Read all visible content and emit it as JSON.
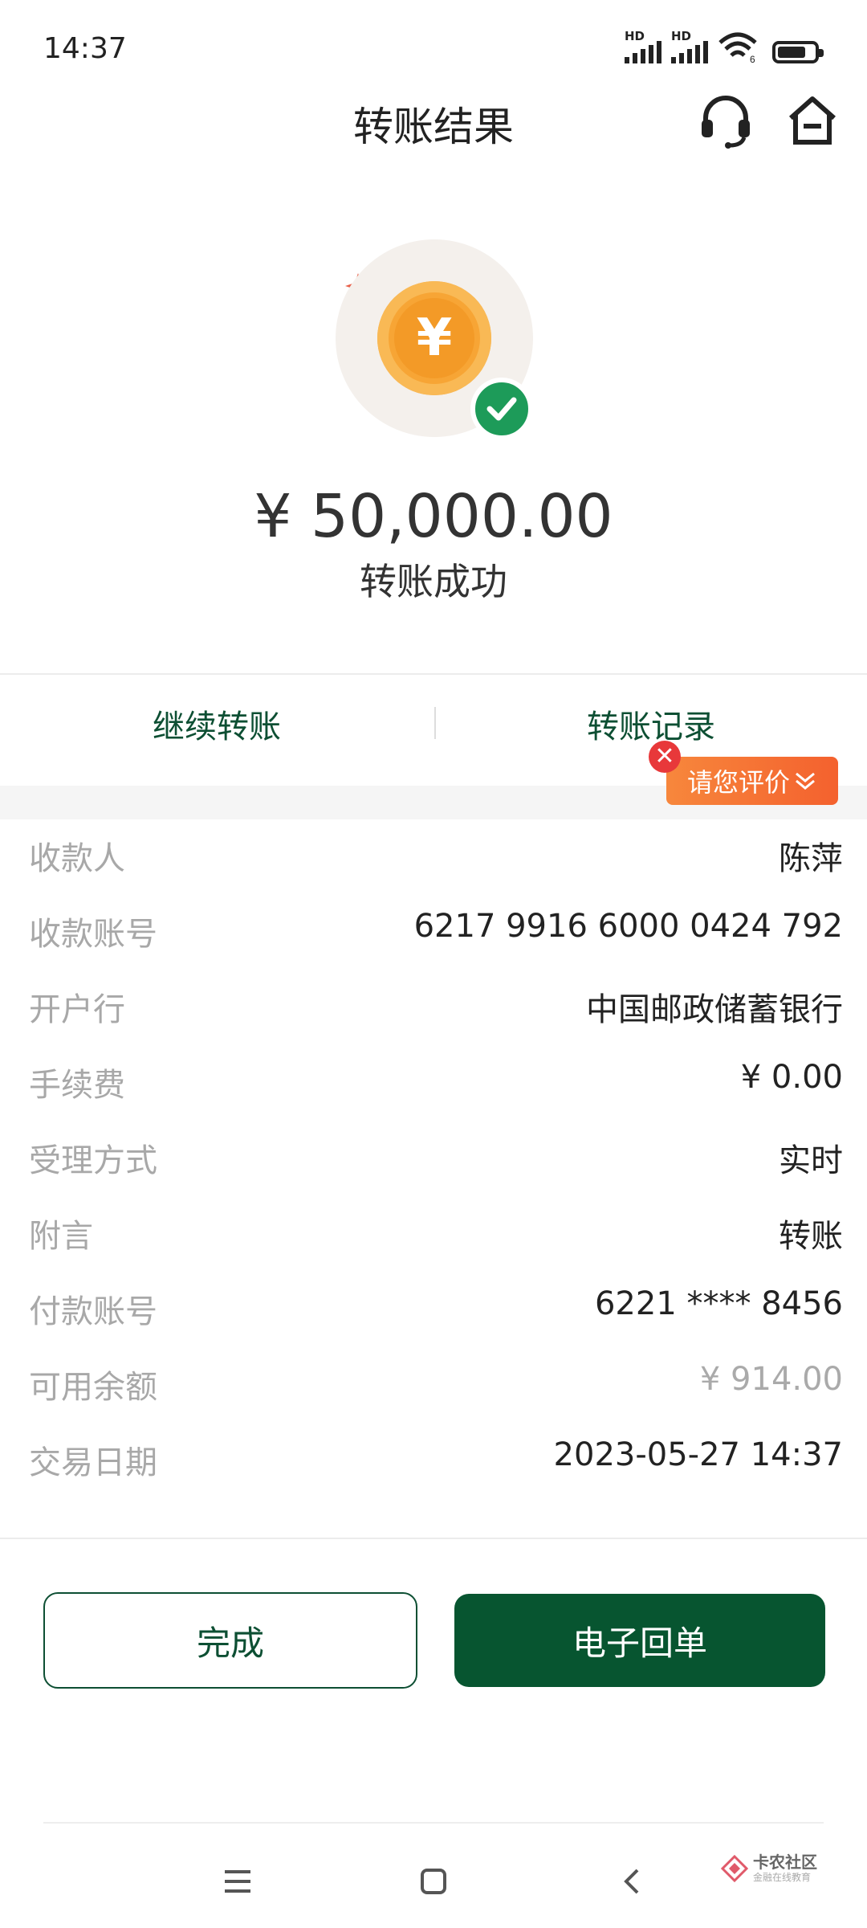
{
  "status_bar": {
    "time": "14:37",
    "hd1": "HD",
    "hd2": "HD",
    "wifi_tag": "6"
  },
  "header": {
    "title": "转账结果"
  },
  "hero": {
    "amount": "¥ 50,000.00",
    "status": "转账成功",
    "coin_symbol": "¥"
  },
  "actions": {
    "continue_transfer": "继续转账",
    "transfer_records": "转账记录"
  },
  "rating": {
    "label": "请您评价",
    "close_symbol": "✕"
  },
  "details": [
    {
      "label": "收款人",
      "value": "陈萍"
    },
    {
      "label": "收款账号",
      "value": "6217 9916 6000 0424 792"
    },
    {
      "label": "开户行",
      "value": "中国邮政储蓄银行"
    },
    {
      "label": "手续费",
      "value": "¥ 0.00"
    },
    {
      "label": "受理方式",
      "value": "实时"
    },
    {
      "label": "附言",
      "value": "转账"
    },
    {
      "label": "付款账号",
      "value": "6221 **** 8456"
    },
    {
      "label": "可用余额",
      "value": "¥ 914.00"
    },
    {
      "label": "交易日期",
      "value": "2023-05-27 14:37"
    }
  ],
  "buttons": {
    "done": "完成",
    "receipt": "电子回单"
  },
  "watermark": {
    "name": "卡农社区",
    "sub": "金融在线教育"
  },
  "colors": {
    "brand_green": "#075530",
    "link_green": "#0d4f33",
    "success_green": "#1d9b59",
    "coin_orange": "#f7a535",
    "rate_orange": "#f4612e"
  },
  "icons": [
    "headset-icon",
    "home-icon",
    "coin-icon",
    "checkmark-icon",
    "sparkle-icon",
    "menu-icon",
    "square-icon",
    "back-icon",
    "close-icon",
    "chevron-down-icon"
  ]
}
